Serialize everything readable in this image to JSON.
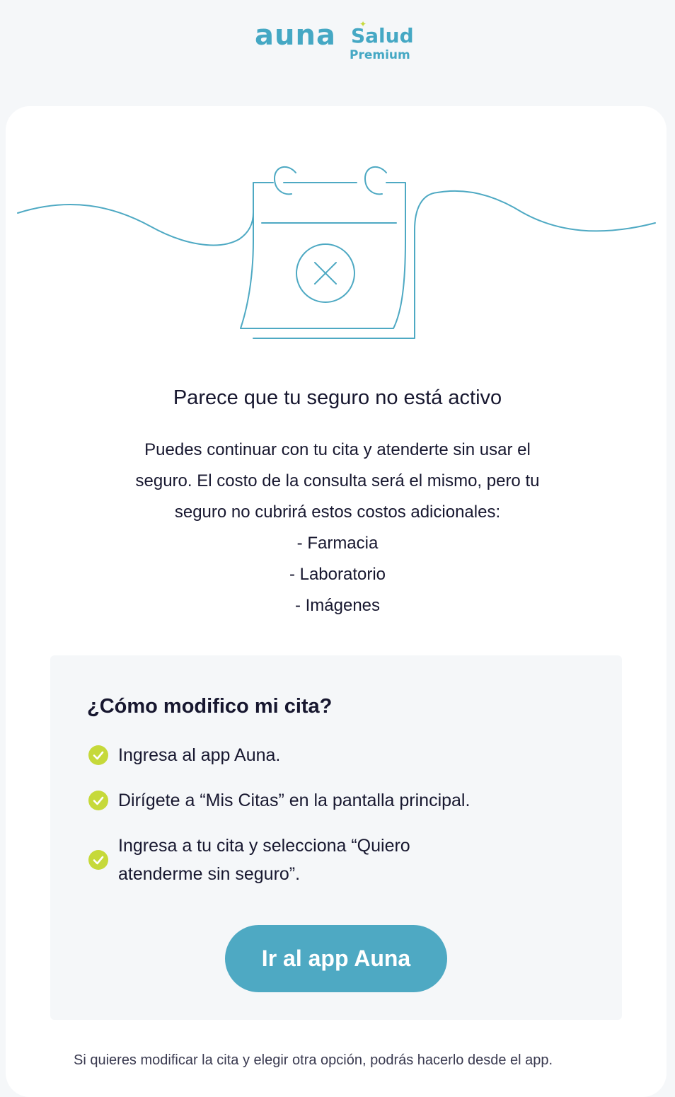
{
  "brand": {
    "logo_main": "auna",
    "logo_sub": "Salud",
    "logo_tier": "Premium",
    "primary_color": "#45a8c4",
    "accent_color": "#c6d93a"
  },
  "illustration": {
    "icon": "calendar-cancel-icon"
  },
  "message": {
    "title": "Parece que tu seguro no está activo",
    "paragraph": [
      "Puedes continuar con tu cita y atenderte sin usar el",
      "seguro. El costo de la consulta será el mismo, pero tu",
      "seguro no cubrirá estos costos adicionales:"
    ],
    "items": [
      "- Farmacia",
      "- Laboratorio",
      "- Imágenes"
    ]
  },
  "steps": {
    "title": "¿Cómo modifico mi cita?",
    "items": [
      "Ingresa al app Auna.",
      "Dirígete a “Mis Citas” en la pantalla principal.",
      "Ingresa a tu cita y selecciona “Quiero",
      "atenderme sin seguro”."
    ],
    "icon": "check-circle-icon"
  },
  "cta": {
    "label": "Ir al app Auna"
  },
  "footer": {
    "text": "Si quieres modificar la cita y elegir otra opción, podrás hacerlo desde el app."
  }
}
